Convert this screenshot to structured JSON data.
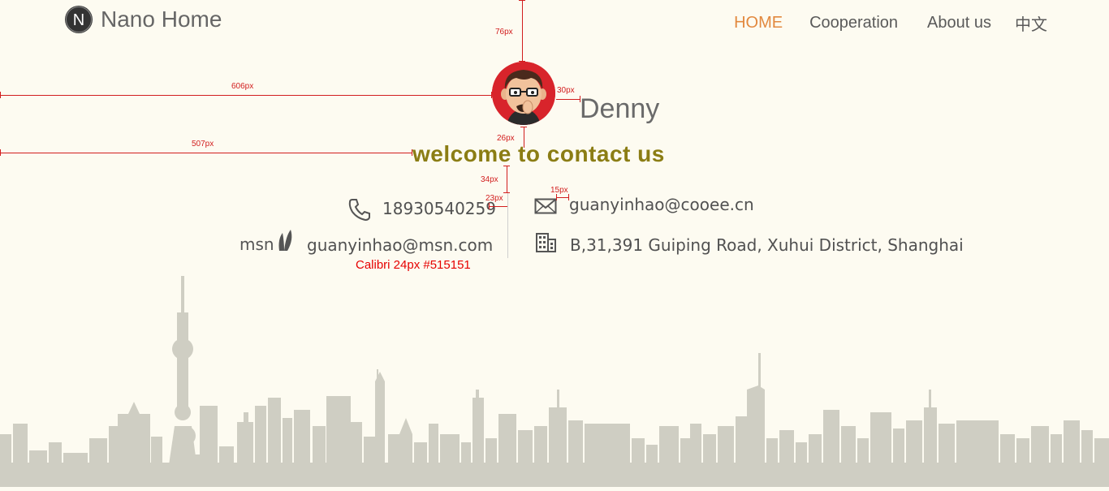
{
  "header": {
    "brand": "Nano Home",
    "logo_letter": "N",
    "nav": [
      {
        "label": "HOME",
        "active": true
      },
      {
        "label": "Cooperation",
        "active": false
      },
      {
        "label": "About us",
        "active": false
      },
      {
        "label": "中文",
        "active": false
      }
    ]
  },
  "profile": {
    "name": "Denny",
    "welcome": "welcome to contact us"
  },
  "contacts": {
    "phone": {
      "icon": "phone-icon",
      "value": "18930540259"
    },
    "msn": {
      "icon": "msn-logo-icon",
      "logo_text": "msn",
      "value": "guanyinhao@msn.com"
    },
    "email": {
      "icon": "envelope-icon",
      "value": "guanyinhao@cooee.cn"
    },
    "address": {
      "icon": "building-icon",
      "value": "B,31,391 Guiping Road, Xuhui District, Shanghai"
    }
  },
  "annotations": {
    "top_gap": "76px",
    "left_gap_avatar": "606px",
    "avatar_name_gap": "30px",
    "avatar_welcome_gap": "26px",
    "left_gap_welcome": "507px",
    "welcome_contacts_gap": "34px",
    "phone_divider_gap": "23px",
    "divider_email_gap": "15px",
    "font_note": "Calibri   24px  #515151"
  },
  "colors": {
    "background": "#fdfbf1",
    "nav_active": "#e2893f",
    "welcome": "#8b7d14",
    "text": "#515151",
    "annotation": "#d21e1e",
    "skyline": "#cfcec3"
  }
}
